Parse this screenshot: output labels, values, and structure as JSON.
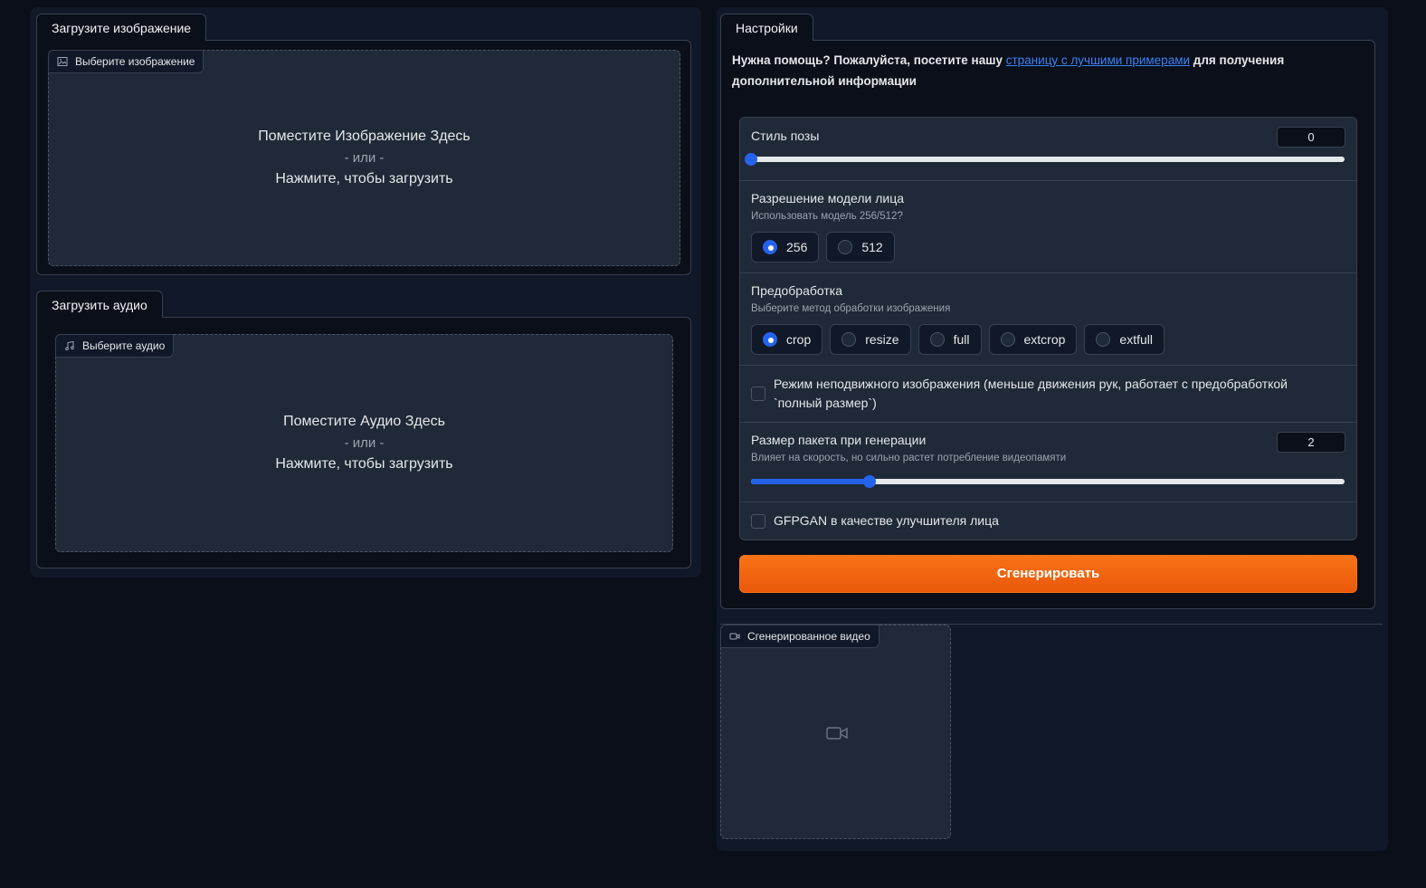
{
  "image_upload": {
    "tab_label": "Загрузите изображение",
    "chip_label": "Выберите изображение",
    "drop_text": "Поместите Изображение Здесь",
    "or_text": "- или -",
    "click_text": "Нажмите, чтобы загрузить"
  },
  "audio_upload": {
    "tab_label": "Загрузить аудио",
    "chip_label": "Выберите аудио",
    "drop_text": "Поместите Аудио Здесь",
    "or_text": "- или -",
    "click_text": "Нажмите, чтобы загрузить"
  },
  "settings": {
    "tab_label": "Настройки",
    "help_prefix": "Нужна помощь? Пожалуйста, посетите нашу ",
    "help_link": "страницу с лучшими примерами",
    "help_suffix": " для получения дополнительной информации",
    "pose_style": {
      "label": "Стиль позы",
      "value": "0",
      "fraction": 0.0
    },
    "face_model": {
      "label": "Разрешение модели лица",
      "info": "Использовать модель 256/512?",
      "options": [
        "256",
        "512"
      ],
      "selected": "256"
    },
    "preprocess": {
      "label": "Предобработка",
      "info": "Выберите метод обработки изображения",
      "options": [
        "crop",
        "resize",
        "full",
        "extcrop",
        "extfull"
      ],
      "selected": "crop"
    },
    "still_mode": {
      "label": "Режим неподвижного изображения (меньше движения рук, работает с предобработкой `полный размер`)",
      "checked": false
    },
    "batch_size": {
      "label": "Размер пакета при генерации",
      "info": "Влияет на скорость, но сильно растет потребление видеопамяти",
      "value": "2",
      "fraction": 0.2
    },
    "gfpgan": {
      "label": "GFPGAN в качестве улучшителя лица",
      "checked": false
    },
    "generate_label": "Сгенерировать"
  },
  "output": {
    "chip_label": "Сгенерированное видео"
  },
  "colors": {
    "accent": "#2563eb",
    "button": "#f97316",
    "background": "#0b0f19"
  }
}
